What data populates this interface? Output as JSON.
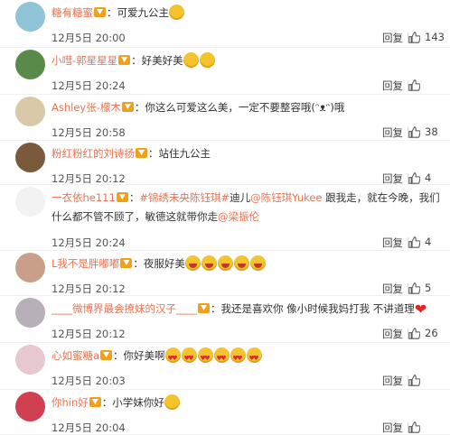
{
  "comments": [
    {
      "user": "糖有糖蜜",
      "text": "：可爱九公主",
      "time": "12月5日 20:00",
      "reply": "回复",
      "likes": "143",
      "emoji": 1
    },
    {
      "user": "小嘒-郭星星星",
      "text": "：好美好美",
      "time": "12月5日 20:24",
      "reply": "回复",
      "likes": "",
      "emoji": 2
    },
    {
      "user": "Ashley张-檬木",
      "text": "：你这么可爱这么美，一定不要整容哦(ᵔᴥᵔ)哦",
      "time": "12月5日 20:58",
      "reply": "回复",
      "likes": "38"
    },
    {
      "user": "粉红粉红的刘诗扬",
      "text": "：站住九公主",
      "time": "12月5日 20:12",
      "reply": "回复",
      "likes": "4"
    },
    {
      "user": "一衣依he111",
      "text_topic": "#锦绣未央陈钰琪#",
      "text_mid": "迪儿",
      "mention1": "@陈钰琪Yukee",
      "text_after": " 跟我走，就在今晚，我们什么都不管不顾了，敏德这就带你走",
      "mention2": "@梁振伦",
      "time": "12月5日 20:24",
      "reply": "回复",
      "likes": "4"
    },
    {
      "user": "L我不是胖嘟嘟",
      "text": "：夜服好美",
      "time": "12月5日 20:12",
      "reply": "回复",
      "likes": "5",
      "emoji": 5
    },
    {
      "user": "____微博界最会撩妹的汉子____",
      "text": "：我还是喜欢你 像小时候我妈打我 不讲道理",
      "time": "12月5日 20:12",
      "reply": "回复",
      "likes": "26"
    },
    {
      "user": "心如蜜糖a",
      "text": "：你好美啊",
      "time": "12月5日 20:03",
      "reply": "回复",
      "likes": "",
      "emoji": 6
    },
    {
      "user": "你hin好",
      "text": "：小学妹你好",
      "time": "12月5日 20:04",
      "reply": "回复",
      "likes": "",
      "emoji": 1
    }
  ],
  "colors": {
    "username": "#eb7350",
    "text": "#333333",
    "vip": "#f0a11c"
  }
}
